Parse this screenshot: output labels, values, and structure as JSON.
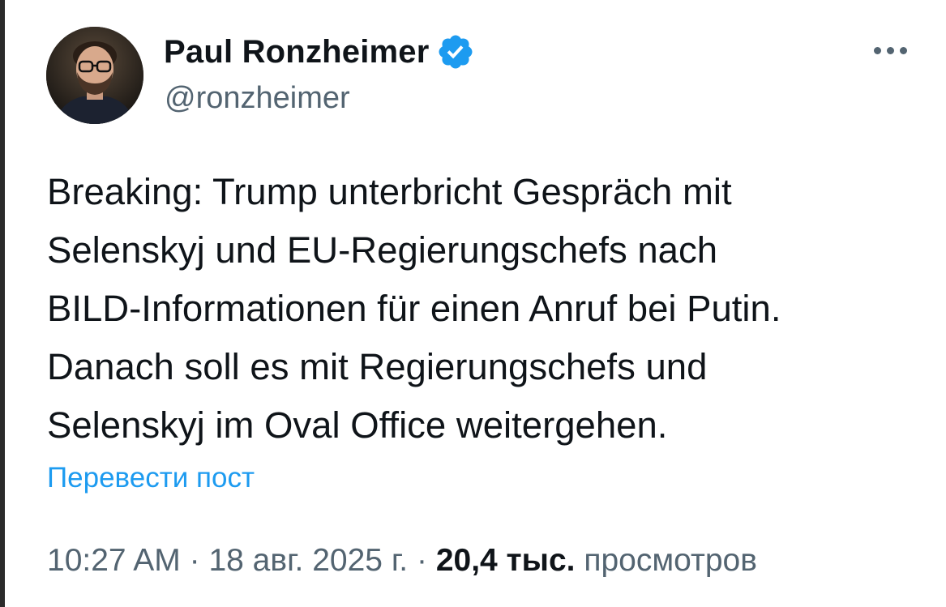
{
  "author": {
    "display_name": "Paul Ronzheimer",
    "handle": "@ronzheimer",
    "verified": true,
    "verified_color": "#1d9bf0"
  },
  "icons": {
    "verified": "verified-badge-icon",
    "more": "more-options-icon"
  },
  "tweet": {
    "text_lines": [
      "Breaking: Trump unterbricht Gespräch mit",
      "Selenskyj und EU-Regierungschefs nach",
      "BILD-Informationen für einen Anruf bei Putin.",
      "Danach soll es mit Regierungschefs und",
      "Selenskyj im Oval Office weitergehen."
    ],
    "translate_label": "Перевести пост"
  },
  "meta": {
    "time": "10:27 AM",
    "separator": "·",
    "date": "18 авг. 2025 г.",
    "views_count": "20,4 тыс.",
    "views_label": "просмотров"
  },
  "colors": {
    "text_primary": "#0f1419",
    "text_secondary": "#536471",
    "link": "#1d9bf0"
  }
}
